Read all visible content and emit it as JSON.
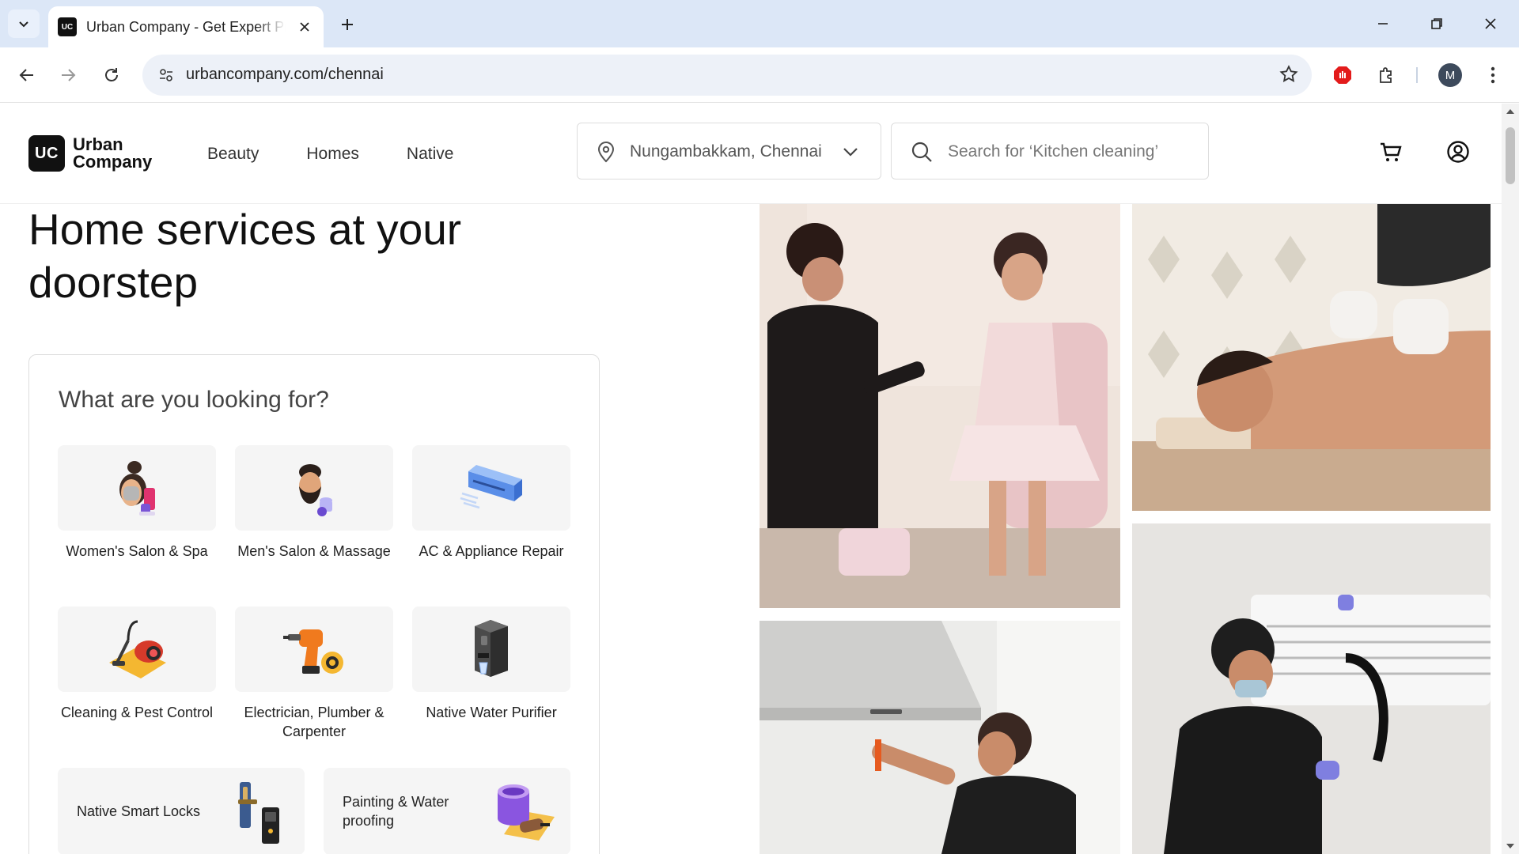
{
  "browser": {
    "tab_title": "Urban Company - Get Expert Pr",
    "favicon_text": "UC",
    "url": "urbancompany.com/chennai",
    "profile_initial": "M"
  },
  "header": {
    "logo_mark": "UC",
    "logo_line1": "Urban",
    "logo_line2": "Company",
    "nav": [
      "Beauty",
      "Homes",
      "Native"
    ],
    "location": "Nungambakkam, Chennai",
    "search_placeholder": "Search for ‘Kitchen cleaning’"
  },
  "hero": {
    "title": "Home services at your doorstep"
  },
  "finder": {
    "title": "What are you looking for?",
    "categories": [
      {
        "label": "Women's Salon & Spa",
        "icon": "women-salon-icon"
      },
      {
        "label": "Men's Salon & Massage",
        "icon": "men-salon-icon"
      },
      {
        "label": "AC & Appliance Repair",
        "icon": "ac-repair-icon"
      },
      {
        "label": "Cleaning & Pest Control",
        "icon": "cleaning-icon"
      },
      {
        "label": "Electrician, Plumber & Carpenter",
        "icon": "drill-icon"
      },
      {
        "label": "Native Water Purifier",
        "icon": "water-purifier-icon"
      }
    ],
    "wide_categories": [
      {
        "label": "Native Smart Locks",
        "icon": "smart-lock-icon"
      },
      {
        "label": "Painting & Water proofing",
        "icon": "paint-bucket-icon"
      }
    ]
  },
  "colors": {
    "tabbar": "#dce7f7",
    "omnibox": "#edf1f8",
    "logo": "#111111",
    "card_bg": "#f5f5f5"
  }
}
